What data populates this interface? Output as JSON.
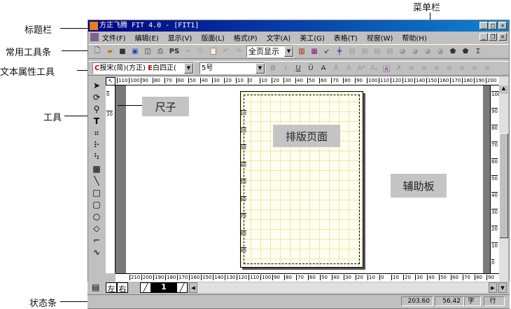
{
  "annotations": {
    "title_bar": "标题栏",
    "menu_bar": "菜单栏",
    "common_toolbar": "常用工具条",
    "text_attr_toolbar": "文本属性工具",
    "tools": "工具",
    "status_bar": "状态条",
    "ruler": "尺子",
    "layout_page": "排版页面",
    "pasteboard": "辅助板"
  },
  "window": {
    "title": "方正飞腾 FIT 4.0 - [FIT1]"
  },
  "menu": [
    "文件(F)",
    "编辑(E)",
    "显示(V)",
    "版面(L)",
    "格式(P)",
    "文字(A)",
    "美工(G)",
    "表格(T)",
    "视窗(W)",
    "帮助(H)"
  ],
  "toolbar": {
    "ps_label": "PS",
    "view_mode": "全页显示"
  },
  "text_attr": {
    "font_cn_prefix": "C",
    "font_cn": "报宋(简)(方正)",
    "font_en_prefix": "E",
    "font_en": "白四正(",
    "size": "5号"
  },
  "rulers": {
    "top": [
      "110",
      "100",
      "90",
      "80",
      "70",
      "60",
      "50",
      "40",
      "30",
      "20",
      "10",
      "0",
      "10",
      "20",
      "30",
      "40",
      "50",
      "60",
      "70",
      "80",
      "90",
      "100",
      "110",
      "120",
      "130",
      "140",
      "150",
      "160",
      "170",
      "180",
      "190",
      "200"
    ],
    "left": [
      "0",
      "10"
    ],
    "right": [
      "100",
      "90",
      "80",
      "70",
      "60",
      "50",
      "40",
      "30",
      "20",
      "10",
      "0"
    ],
    "page_inner": [
      "10",
      "20",
      "30",
      "40",
      "50",
      "60",
      "70",
      "80",
      "90"
    ],
    "bottom": [
      "210",
      "200",
      "190",
      "180",
      "170",
      "160",
      "150",
      "140",
      "130",
      "120",
      "110",
      "100",
      "90",
      "80",
      "70",
      "60",
      "50",
      "40",
      "30",
      "20",
      "10",
      "0",
      "10",
      "20",
      "30",
      "40",
      "50",
      "60",
      "70",
      "80",
      "90"
    ]
  },
  "page_tabs": {
    "left": "左",
    "right": "右",
    "current_page": "1"
  },
  "status": {
    "x": "203.60",
    "y": "56.42",
    "unit1": "字",
    "unit2": "行"
  }
}
